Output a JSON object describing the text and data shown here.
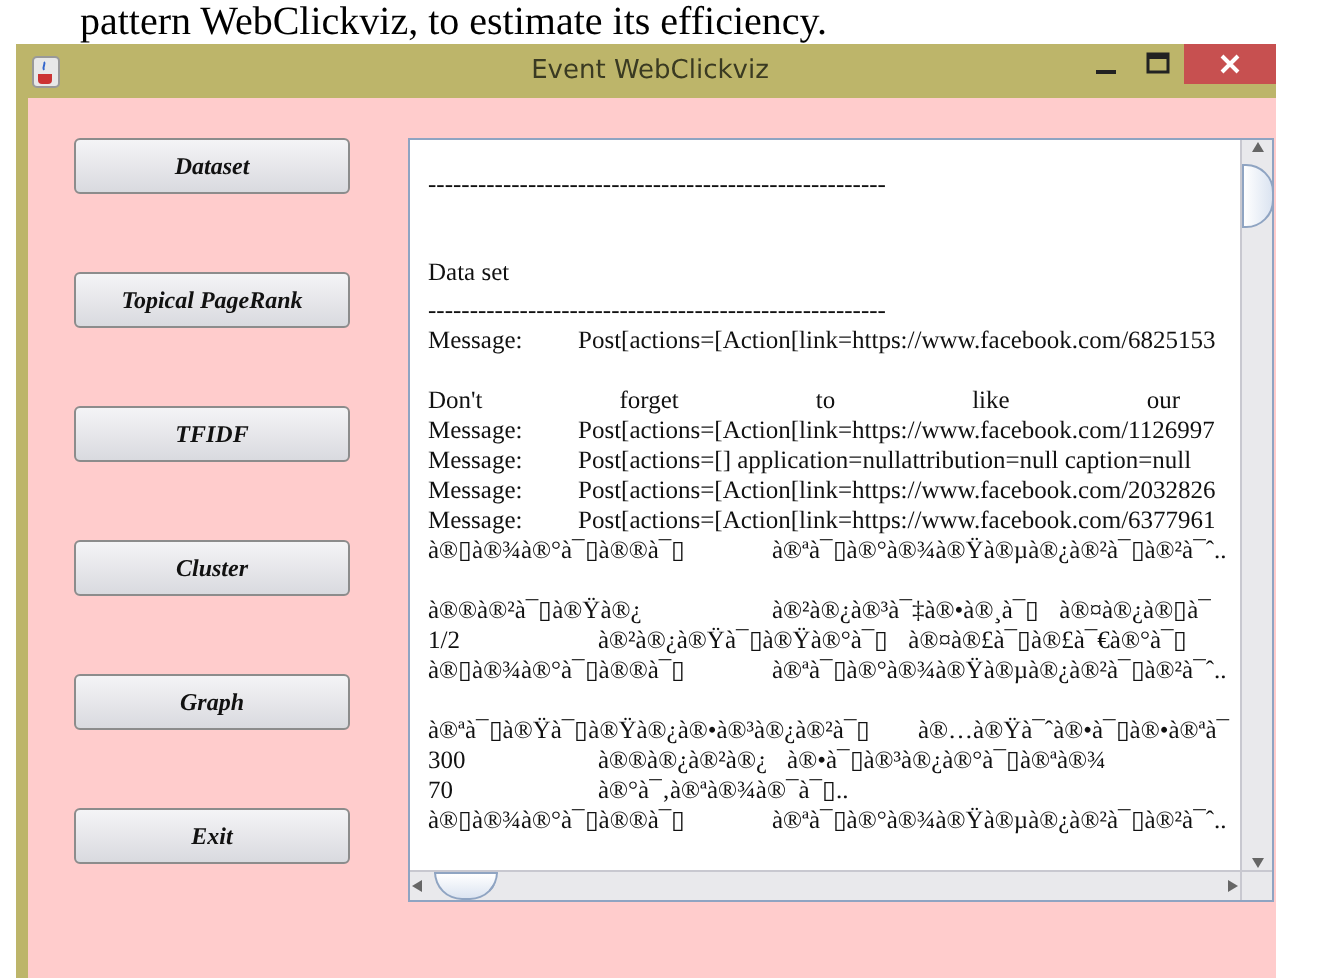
{
  "caption_fragment": "pattern WebClickviz, to estimate its efficiency.",
  "window": {
    "title": "Event WebClickviz"
  },
  "buttons": [
    "Dataset",
    "Topical PageRank",
    "TFIDF",
    "Cluster",
    "Graph",
    "Exit"
  ],
  "output": {
    "lines": [
      {
        "kind": "rule",
        "cells": [
          "-------------------------------------------------------"
        ]
      },
      {
        "kind": "blank"
      },
      {
        "kind": "heading",
        "cells": [
          "Data set"
        ]
      },
      {
        "kind": "rule",
        "cells": [
          "-------------------------------------------------------"
        ]
      },
      {
        "kind": "message",
        "cells": [
          "Message:",
          "Post[actions=[Action[link=https://www.facebook.com/6825153"
        ]
      },
      {
        "kind": "blank"
      },
      {
        "kind": "justify",
        "cells": [
          "Don't",
          "forget",
          "to",
          "like",
          "our"
        ]
      },
      {
        "kind": "message",
        "cells": [
          "Message:",
          "Post[actions=[Action[link=https://www.facebook.com/1126997"
        ]
      },
      {
        "kind": "message",
        "cells": [
          "Message:",
          "Post[actions=[]   application=nullattribution=null caption=null"
        ]
      },
      {
        "kind": "message",
        "cells": [
          "Message:",
          "Post[actions=[Action[link=https://www.facebook.com/2032826"
        ]
      },
      {
        "kind": "message",
        "cells": [
          "Message:",
          "Post[actions=[Action[link=https://www.facebook.com/6377961"
        ]
      },
      {
        "kind": "garbled",
        "cells": [
          "à®▯à®¾à®°à¯▯à®®à¯▯",
          "à®ªà¯▯à®°à®¾à®Ÿà®µà®¿à®²à¯▯à®²à¯ˆ.."
        ]
      },
      {
        "kind": "blank"
      },
      {
        "kind": "garbled",
        "cells": [
          "à®®à®²à¯▯à®Ÿà®¿",
          "à®²à®¿à®³à¯‡à®•à®¸à¯▯",
          "à®¤à®¿à®▯à¯"
        ]
      },
      {
        "kind": "numbered",
        "cells": [
          "1/2",
          "à®²à®¿à®Ÿà¯▯à®Ÿà®°à¯▯",
          "à®¤à®£à¯▯à®£à¯€à®°à¯▯"
        ]
      },
      {
        "kind": "garbled",
        "cells": [
          "à®▯à®¾à®°à¯▯à®®à¯▯",
          "à®ªà¯▯à®°à®¾à®Ÿà®µà®¿à®²à¯▯à®²à¯ˆ.."
        ]
      },
      {
        "kind": "blank"
      },
      {
        "kind": "wide",
        "cells": [
          "à®ªà¯▯à®Ÿà¯▯à®Ÿà®¿à®•à®³à®¿à®²à¯▯",
          "à®…à®Ÿà¯ˆà®•à¯▯à®•à®ªà¯"
        ]
      },
      {
        "kind": "numbered",
        "cells": [
          "300",
          "à®®à®¿à®²à®¿",
          "à®•à¯▯à®³à®¿à®°à¯▯à®ªà®¾"
        ]
      },
      {
        "kind": "numbered",
        "cells": [
          "70",
          "à®°à¯‚à®ªà®¾à®¯à¯▯.."
        ]
      },
      {
        "kind": "garbled",
        "cells": [
          "à®▯à®¾à®°à¯▯à®®à¯▯",
          "à®ªà¯▯à®°à®¾à®Ÿà®µà®¿à®²à¯▯à®²à¯ˆ.."
        ]
      }
    ]
  }
}
